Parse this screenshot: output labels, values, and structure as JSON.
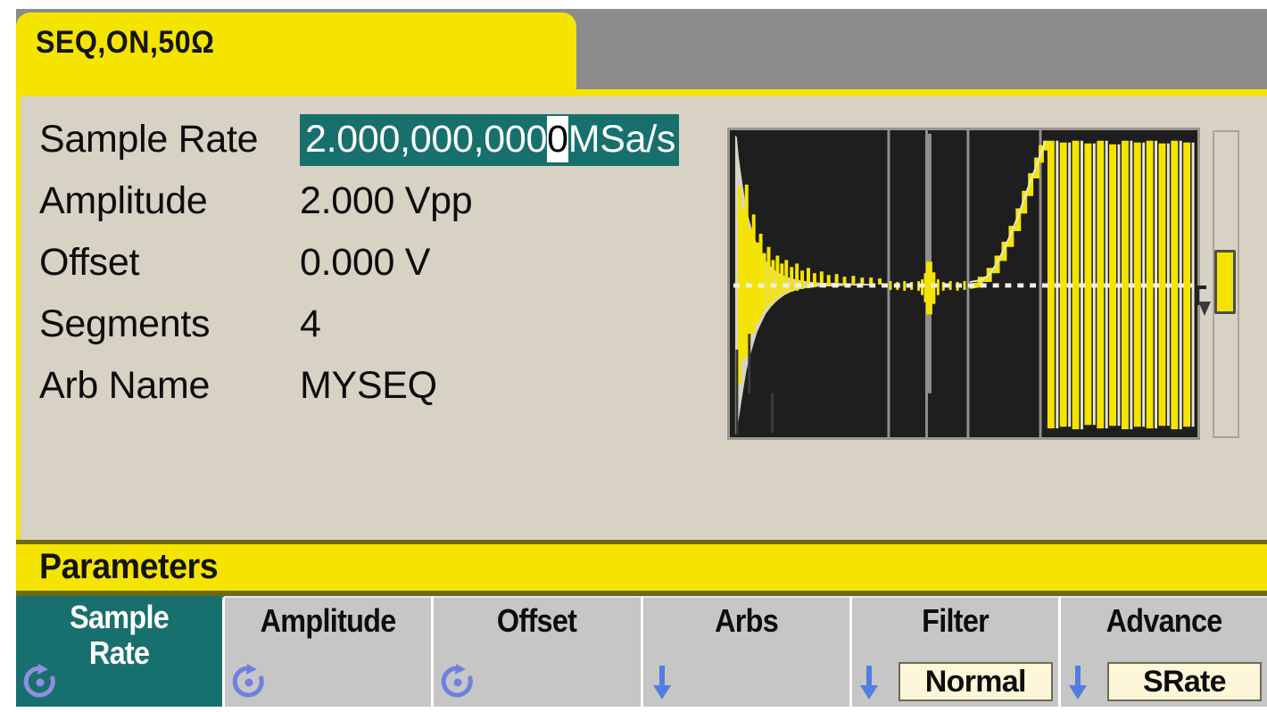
{
  "window": {
    "tab_label": "SEQ,ON,50Ω",
    "colors": {
      "tab_yellow": "#f5e400",
      "panel_beige": "#d8d2c4",
      "highlight_teal": "#18706e",
      "waveform_yellow": "#f5e400",
      "plot_background": "#1e1e1e",
      "softkey_grey": "#c6c6c6",
      "value_box_cream": "#fdf6d8"
    }
  },
  "parameters": [
    {
      "label": "Sample Rate",
      "value": "2.000,000,000",
      "cursor_digit": "0",
      "unit": "MSa/s",
      "editing": true
    },
    {
      "label": "Amplitude",
      "value": "2.000 Vpp",
      "editing": false
    },
    {
      "label": "Offset",
      "value": "0.000 V",
      "editing": false
    },
    {
      "label": "Segments",
      "value": "4",
      "editing": false
    },
    {
      "label": "Arb Name",
      "value": "MYSEQ",
      "editing": false
    }
  ],
  "waveform": {
    "name": "sequence-preview",
    "segment_count": 4,
    "segments": [
      {
        "index": 1,
        "shape": "damped-sine-burst",
        "description": "exponentially decaying sine burst"
      },
      {
        "index": 2,
        "shape": "flat-with-spike",
        "description": "quiet baseline with narrow pulse spike"
      },
      {
        "index": 3,
        "shape": "exponential-rise",
        "description": "stair-stepped exponential ramp up"
      },
      {
        "index": 4,
        "shape": "high-frequency-sine",
        "description": "full-amplitude high frequency sine"
      }
    ],
    "center_line": "dashed",
    "gridlines": true
  },
  "scrollbar": {
    "name": "waveform-vertical-scrollbar",
    "thumb_position_percent": 39
  },
  "menu": {
    "title": "Parameters"
  },
  "softkeys": [
    {
      "label": "Sample\nRate",
      "label_line1": "Sample",
      "label_line2": "Rate",
      "icon": "rotary-knob-icon",
      "selected": true,
      "value": null
    },
    {
      "label": "Amplitude",
      "icon": "rotary-knob-icon",
      "selected": false,
      "value": null
    },
    {
      "label": "Offset",
      "icon": "rotary-knob-icon",
      "selected": false,
      "value": null
    },
    {
      "label": "Arbs",
      "icon": "down-arrow-icon",
      "selected": false,
      "value": null
    },
    {
      "label": "Filter",
      "icon": "down-arrow-icon",
      "selected": false,
      "value": "Normal"
    },
    {
      "label": "Advance",
      "icon": "down-arrow-icon",
      "selected": false,
      "value": "SRate"
    }
  ]
}
